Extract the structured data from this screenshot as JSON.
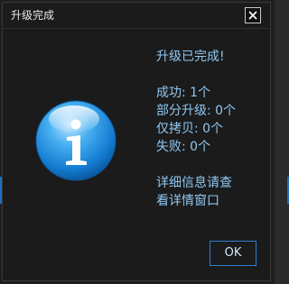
{
  "dialog": {
    "title": "升级完成",
    "close_glyph": "×",
    "icon": "info-icon",
    "messages": {
      "headline": "升级已完成!",
      "success": "成功: 1个",
      "partial": "部分升级: 0个",
      "copy_only": "仅拷贝: 0个",
      "failed": "失败: 0个",
      "detail_line1": "详细信息请查",
      "detail_line2": "看详情窗口"
    },
    "ok_label": "OK"
  },
  "colors": {
    "accent": "#2f7fd0",
    "message_text": "#8ec7f2",
    "background": "#1b1b1b"
  }
}
